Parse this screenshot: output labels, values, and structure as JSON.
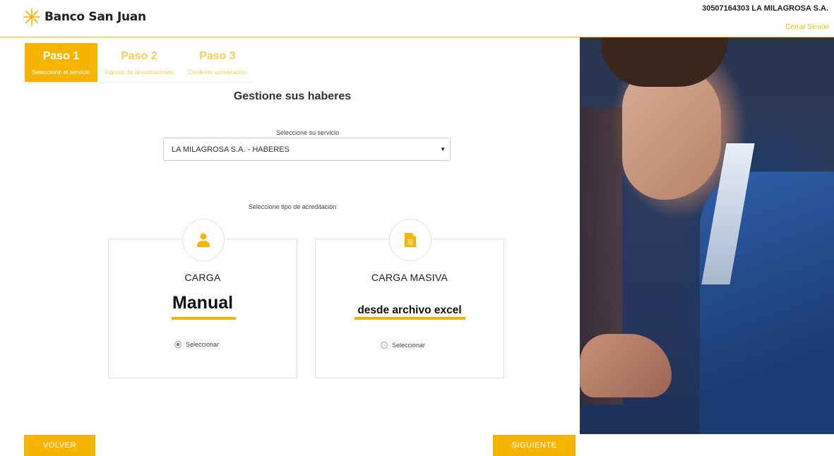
{
  "header": {
    "brand": "Banco San Juan",
    "account": "30507164303 LA MILAGROSA S.A.",
    "logout": "Cerrar Sesión"
  },
  "steps": [
    {
      "label": "Paso 1",
      "desc": "Seleccione el servicio"
    },
    {
      "label": "Paso 2",
      "desc": "Ingreso de acreditaciones"
    },
    {
      "label": "Paso 3",
      "desc": "Confirme acreditación"
    }
  ],
  "main": {
    "title": "Gestione sus haberes",
    "service_label": "Seleccione su servicio",
    "service_value": "LA MILAGROSA S.A. - HABERES",
    "tipo_label": "Seleccione tipo de acreditación"
  },
  "cards": [
    {
      "head": "CARGA",
      "big": "Manual",
      "radio_label": "Seleccionar",
      "selected": true,
      "icon": "user-icon"
    },
    {
      "head": "CARGA MASIVA",
      "big": "desde archivo excel",
      "radio_label": "Seleccionar",
      "selected": false,
      "icon": "document-icon"
    }
  ],
  "buttons": {
    "back": "VOLVER",
    "next": "SIGUIENTE"
  },
  "colors": {
    "accent": "#f5b400",
    "accent_light": "#f7cf5a"
  }
}
